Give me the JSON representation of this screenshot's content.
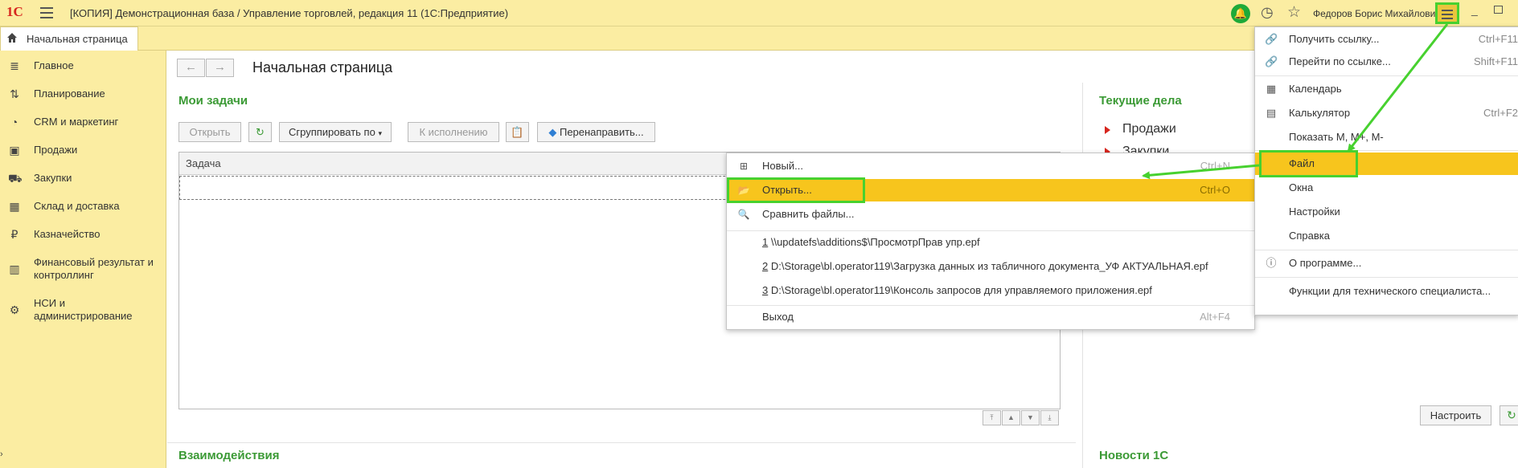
{
  "titlebar": {
    "logo": "1С",
    "title": "[КОПИЯ] Демонстрационная база / Управление торговлей, редакция 11  (1С:Предприятие)",
    "user": "Федоров Борис Михайлович"
  },
  "tabs": {
    "home": "Начальная страница"
  },
  "sidebar": {
    "items": [
      {
        "label": "Главное",
        "icon": "≣"
      },
      {
        "label": "Планирование",
        "icon": "⇅"
      },
      {
        "label": "CRM и маркетинг",
        "icon": "◔"
      },
      {
        "label": "Продажи",
        "icon": "▣"
      },
      {
        "label": "Закупки",
        "icon": "⛟"
      },
      {
        "label": "Склад и доставка",
        "icon": "▦"
      },
      {
        "label": "Казначейство",
        "icon": "₽"
      },
      {
        "label": "Финансовый результат и контроллинг",
        "icon": "▥"
      },
      {
        "label": "НСИ и администрирование",
        "icon": "⚙"
      }
    ]
  },
  "main": {
    "page_title": "Начальная страница",
    "my_tasks": {
      "title": "Мои задачи",
      "btn_open": "Открыть",
      "btn_group": "Сгруппировать по",
      "btn_exec": "К исполнению",
      "btn_redirect": "Перенаправить...",
      "col_task": "Задача"
    },
    "interaction": "Взаимодействия",
    "current": {
      "title": "Текущие дела",
      "sales": "Продажи",
      "purchases": "Закупки"
    },
    "news": "Новости 1С",
    "setup_btn": "Настроить"
  },
  "main_menu": {
    "get_link": {
      "label": "Получить ссылку...",
      "shortcut": "Ctrl+F11"
    },
    "go_link": {
      "label": "Перейти по ссылке...",
      "shortcut": "Shift+F11"
    },
    "calendar": {
      "label": "Календарь"
    },
    "calculator": {
      "label": "Калькулятор",
      "shortcut": "Ctrl+F2"
    },
    "show_m": {
      "label": "Показать М, М+, М-"
    },
    "file": {
      "label": "Файл"
    },
    "windows": {
      "label": "Окна"
    },
    "settings": {
      "label": "Настройки"
    },
    "help": {
      "label": "Справка"
    },
    "about": {
      "label": "О программе..."
    },
    "tech": {
      "label": "Функции для технического специалиста..."
    }
  },
  "file_menu": {
    "new": {
      "label": "Новый...",
      "shortcut": "Ctrl+N"
    },
    "open": {
      "label": "Открыть...",
      "shortcut": "Ctrl+O"
    },
    "compare": {
      "label": "Сравнить файлы..."
    },
    "recent": [
      {
        "num": "1",
        "path": " \\\\updatefs\\additions$\\ПросмотрПрав упр.epf"
      },
      {
        "num": "2",
        "path": " D:\\Storage\\bl.operator119\\Загрузка данных из табличного документа_УФ АКТУАЛЬНАЯ.epf"
      },
      {
        "num": "3",
        "path": " D:\\Storage\\bl.operator119\\Консоль запросов для управляемого приложения.epf"
      }
    ],
    "exit": {
      "label": "Выход",
      "shortcut": "Alt+F4"
    }
  },
  "colors": {
    "panel": "#fbeda2",
    "highlight": "#f7c51d",
    "accent_green": "#3b9a35",
    "annotation": "#47d12f"
  }
}
